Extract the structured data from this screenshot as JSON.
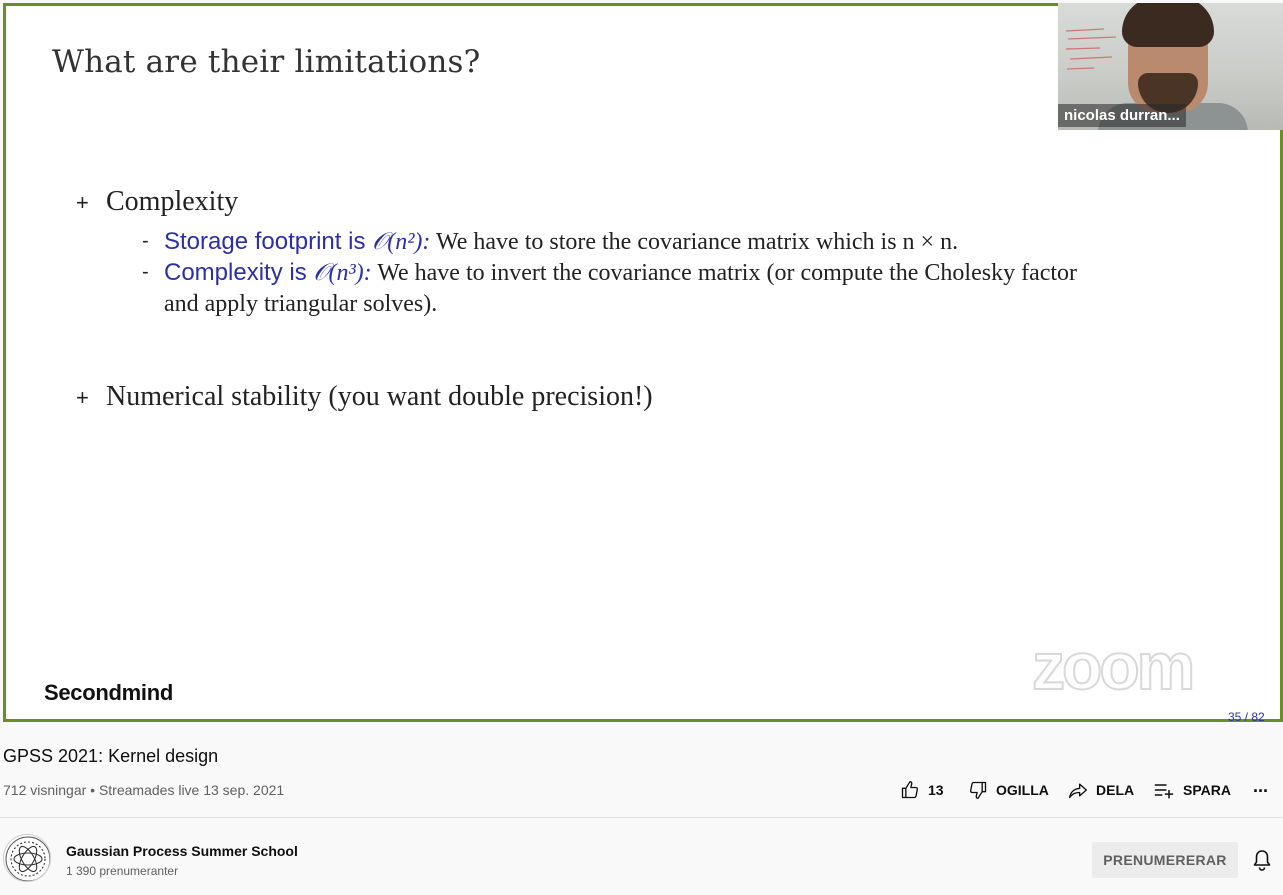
{
  "slide": {
    "title": "What are their limitations?",
    "bullet1": "Complexity",
    "sub1_label": "Storage footprint is ",
    "sub1_math": "𝒪(n²):",
    "sub1_text": "We have to store the covariance matrix which is n × n.",
    "sub2_label": "Complexity is ",
    "sub2_math": "𝒪(n³):",
    "sub2_text": "We have to invert the covariance matrix (or compute the Cholesky factor",
    "sub2_text_cont": "and apply triangular solves).",
    "bullet2": "Numerical stability (you want double precision!)",
    "bullet_marker": "+",
    "sub_marker": "-",
    "brand": "Secondmind",
    "watermark": "zoom",
    "page": "35 / 82"
  },
  "camera": {
    "participant": "nicolas durran..."
  },
  "video": {
    "title": "GPSS 2021: Kernel design",
    "meta": "712 visningar • Streamades live 13 sep. 2021",
    "like_count": "13",
    "dislike_label": "OGILLA",
    "share_label": "DELA",
    "save_label": "SPARA",
    "more_label": "..."
  },
  "channel": {
    "name": "Gaussian Process Summer School",
    "subscribers": "1 390 prenumeranter",
    "subscribe_label": "PRENUMERERAR"
  },
  "colors": {
    "slide_border": "#6b8e23",
    "highlight_text": "#2b2fa8"
  }
}
